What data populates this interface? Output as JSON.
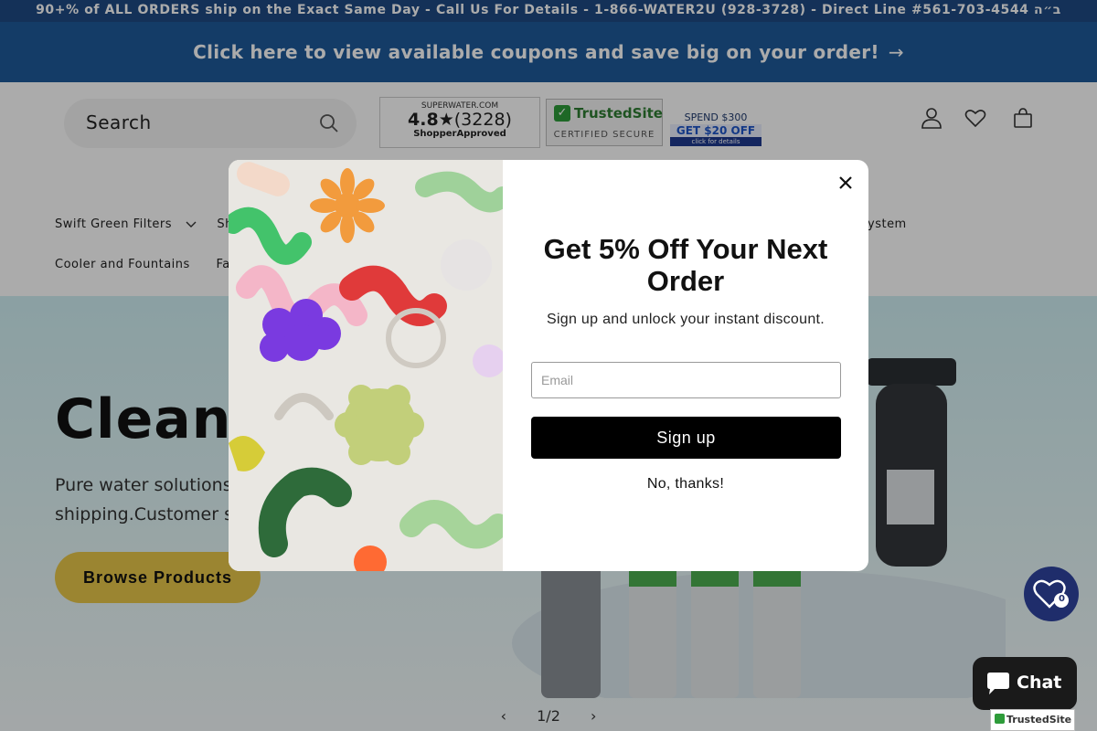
{
  "announcement": {
    "text": "90+% of ALL ORDERS ship on the Exact Same Day - Call Us For Details - 1-866-WATER2U (928-3728) - Direct Line #561-703-4544 ב״ה"
  },
  "coupon_bar": {
    "text": "Click here to view available coupons and save big on your order!",
    "arrow": "→"
  },
  "header": {
    "search_label": "Search",
    "icons": [
      "search-icon",
      "account-icon",
      "wishlist-icon",
      "cart-icon"
    ],
    "shopper_approved": {
      "site": "SUPERWATER.COM",
      "rating": "4.8",
      "star": "★",
      "count": "(3228)",
      "brand": "ShopperApproved"
    },
    "trusted_site": {
      "name": "TrustedSite",
      "tagline": "CERTIFIED SECURE",
      "check": "✓"
    },
    "promo_badge": {
      "line1": "SPEND $300",
      "line2": "GET $20 OFF",
      "line3": "click for details"
    }
  },
  "nav": {
    "row1_first": "Swift Green Filters",
    "row1_second_partial": "Shop",
    "row1_last_partial": "ystem",
    "row2_first": "Cooler and Fountains",
    "row2_second_partial": "Fauc"
  },
  "hero": {
    "title_partial": "Clean W",
    "subtitle_line1_partial": "Pure water solutions y",
    "subtitle_line2_partial": "shipping.Customer sa",
    "cta": "Browse Products",
    "pager": {
      "prev": "‹",
      "label": "1/2",
      "next": "›"
    }
  },
  "modal": {
    "title": "Get 5% Off Your Next Order",
    "subtitle": "Sign up and unlock your instant discount.",
    "email_placeholder": "Email",
    "signup_label": "Sign up",
    "decline_label": "No, thanks!",
    "close_icon": "close-icon"
  },
  "floating": {
    "wishlist_count": "0",
    "chat_label": "Chat",
    "trusted_badge": "TrustedSite"
  },
  "colors": {
    "announcement_bg": "#1f4a84",
    "coupon_bg": "#1f5a9a",
    "cta_yellow": "#e8c649",
    "hero_bg": "#cfeff3",
    "wishlist_fab": "#1f2d6b",
    "chat_bg": "#1a1a1a"
  }
}
